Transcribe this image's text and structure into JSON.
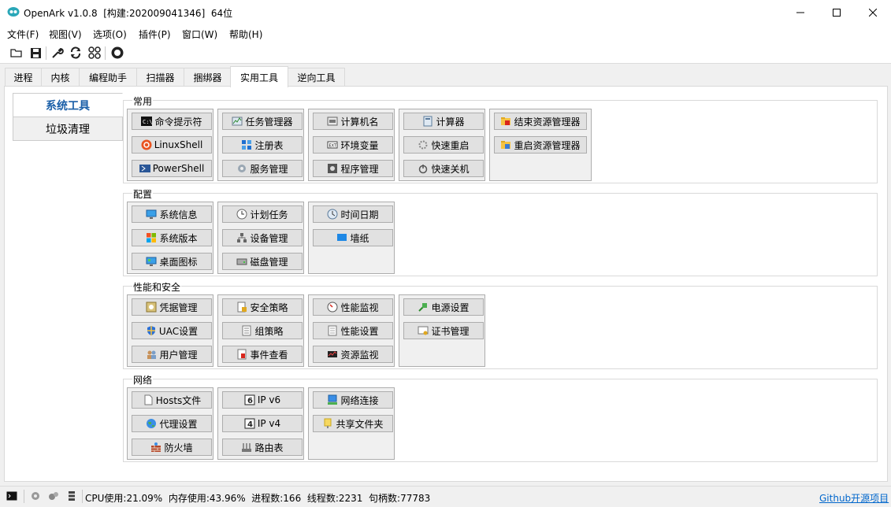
{
  "window": {
    "title": "OpenArk v1.0.8  [构建:202009041346]  64位"
  },
  "menu": [
    "文件(F)",
    "视图(V)",
    "选项(O)",
    "插件(P)",
    "窗口(W)",
    "帮助(H)"
  ],
  "tabs": [
    "进程",
    "内核",
    "编程助手",
    "扫描器",
    "捆绑器",
    "实用工具",
    "逆向工具"
  ],
  "active_tab": "实用工具",
  "left_nav": [
    "系统工具",
    "垃圾清理"
  ],
  "groups": {
    "common": {
      "label": "常用",
      "col1": [
        "命令提示符",
        "LinuxShell",
        "PowerShell"
      ],
      "col2": [
        "任务管理器",
        "注册表",
        "服务管理"
      ],
      "col3": [
        "计算机名",
        "环境变量",
        "程序管理"
      ],
      "col4": [
        "计算器",
        "快速重启",
        "快速关机"
      ],
      "col5": [
        "结束资源管理器",
        "重启资源管理器"
      ]
    },
    "config": {
      "label": "配置",
      "col1": [
        "系统信息",
        "系统版本",
        "桌面图标"
      ],
      "col2": [
        "计划任务",
        "设备管理",
        "磁盘管理"
      ],
      "col3": [
        "时间日期",
        "墙纸"
      ]
    },
    "security": {
      "label": "性能和安全",
      "col1": [
        "凭据管理",
        "UAC设置",
        "用户管理"
      ],
      "col2": [
        "安全策略",
        "组策略",
        "事件查看"
      ],
      "col3": [
        "性能监视",
        "性能设置",
        "资源监视"
      ],
      "col4": [
        "电源设置",
        "证书管理"
      ]
    },
    "network": {
      "label": "网络",
      "col1": [
        "Hosts文件",
        "代理设置",
        "防火墙"
      ],
      "col2": [
        "IP v6",
        "IP v4",
        "路由表"
      ],
      "col3": [
        "网络连接",
        "共享文件夹"
      ]
    }
  },
  "status": {
    "text": "CPU使用:21.09%  内存使用:43.96%  进程数:166  线程数:2231  句柄数:77783",
    "link": "Github开源项目"
  },
  "colors": {
    "accent": "#1a5fa8",
    "link": "#0066cc"
  }
}
